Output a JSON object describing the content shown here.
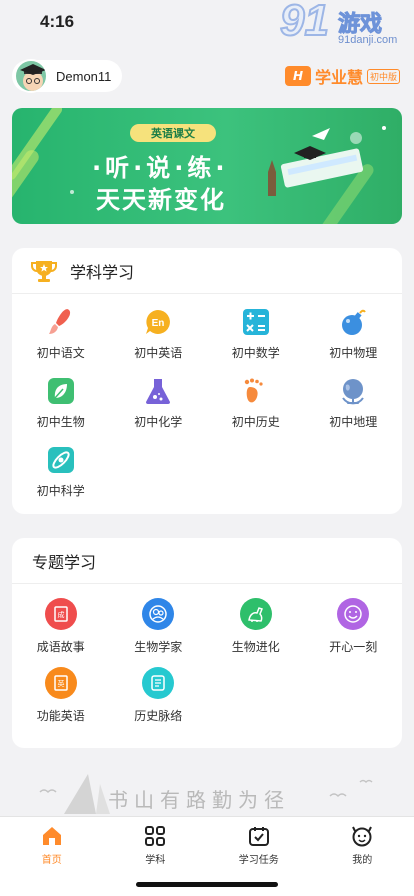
{
  "status": {
    "time": "4:16"
  },
  "watermark": {
    "number": "91",
    "text": "游戏",
    "site": "91danji.com"
  },
  "user": {
    "name": "Demon11"
  },
  "brand": {
    "logo": "H",
    "name": "学业慧",
    "sub": "初中版"
  },
  "banner": {
    "tag": "英语课文",
    "line1": "·听·说·练·",
    "line2": "天天新变化"
  },
  "subjects": {
    "title": "学科学习",
    "items": [
      {
        "label": "初中语文",
        "icon": "brush-icon",
        "color": "#f0604f"
      },
      {
        "label": "初中英语",
        "icon": "english-bubble-icon",
        "color": "#f6b020"
      },
      {
        "label": "初中数学",
        "icon": "calculator-icon",
        "color": "#26b4d9"
      },
      {
        "label": "初中物理",
        "icon": "bomb-icon",
        "color": "#3b8fe0"
      },
      {
        "label": "初中生物",
        "icon": "leaf-icon",
        "color": "#3fbf72"
      },
      {
        "label": "初中化学",
        "icon": "flask-icon",
        "color": "#7762d8"
      },
      {
        "label": "初中历史",
        "icon": "footprint-icon",
        "color": "#f68a3c"
      },
      {
        "label": "初中地理",
        "icon": "globe-icon",
        "color": "#6e93c9"
      },
      {
        "label": "初中科学",
        "icon": "atom-icon",
        "color": "#29c0bd"
      }
    ]
  },
  "topics": {
    "title": "专题学习",
    "items": [
      {
        "label": "成语故事",
        "icon": "book-icon",
        "color": "#ef4d4d"
      },
      {
        "label": "生物学家",
        "icon": "scientist-icon",
        "color": "#2f86e8"
      },
      {
        "label": "生物进化",
        "icon": "dinosaur-icon",
        "color": "#2ebf6b"
      },
      {
        "label": "开心一刻",
        "icon": "smile-icon",
        "color": "#b065e3"
      },
      {
        "label": "功能英语",
        "icon": "english-doc-icon",
        "color": "#f88a1c"
      },
      {
        "label": "历史脉络",
        "icon": "scroll-icon",
        "color": "#26c9d0"
      }
    ]
  },
  "slogan": "书山有路勤为径",
  "tabs": [
    {
      "label": "首页",
      "icon": "home-icon",
      "active": true
    },
    {
      "label": "学科",
      "icon": "grid-icon",
      "active": false
    },
    {
      "label": "学习任务",
      "icon": "task-calendar-icon",
      "active": false
    },
    {
      "label": "我的",
      "icon": "profile-face-icon",
      "active": false
    }
  ],
  "accent": "#ff8b2b"
}
